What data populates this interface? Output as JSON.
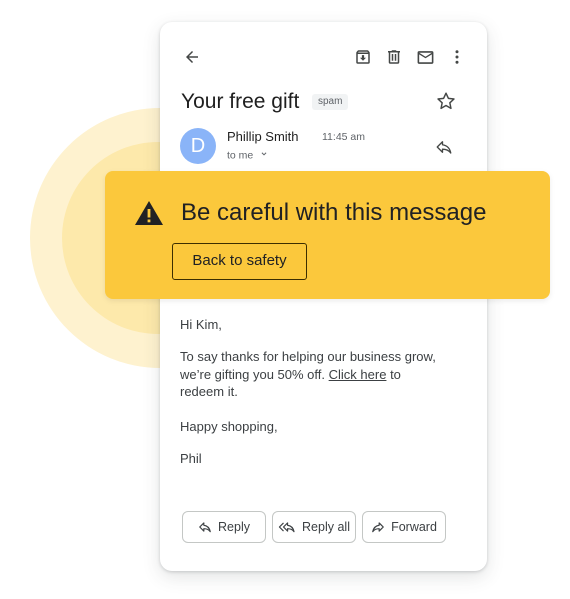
{
  "email": {
    "subject": "Your free gift",
    "label": "spam",
    "sender": {
      "initial": "D",
      "name": "Phillip Smith",
      "time": "11:45 am",
      "recipient": "to me"
    },
    "body": {
      "greeting": "Hi Kim,",
      "paragraph_before_link": "To say thanks for helping our business grow, we’re gifting you 50% off.",
      "link_text": "Click here",
      "paragraph_after_link": "to redeem it.",
      "closing": "Happy shopping,",
      "signature": "Phil"
    }
  },
  "warning": {
    "title": "Be careful with this message",
    "button_label": "Back to safety",
    "color": "#fbc83c"
  },
  "actions": {
    "reply": "Reply",
    "reply_all": "Reply all",
    "forward": "Forward"
  },
  "toolbar": {
    "icons": [
      "back-arrow-icon",
      "archive-icon",
      "delete-icon",
      "mark-unread-icon",
      "more-vert-icon"
    ]
  },
  "colors": {
    "avatar": "#8ab4f8",
    "halo_outer": "#fef2cf",
    "halo_inner": "#fde9ab"
  }
}
